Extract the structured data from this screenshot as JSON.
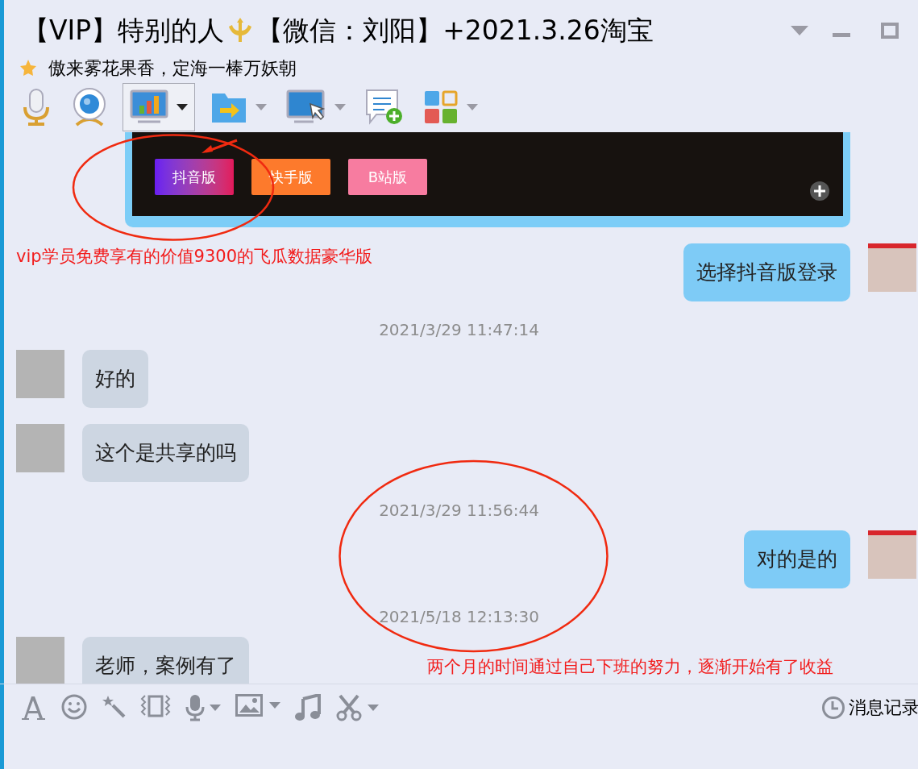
{
  "window": {
    "title": "【VIP】特别的人",
    "title_suffix": "【微信：刘阳】+2021.3.26淘宝",
    "signature": "傲来雾花果香，定海一棒万妖朝"
  },
  "toolbar": [
    {
      "kind": "mic",
      "selected": false,
      "dropdown": false
    },
    {
      "kind": "camera",
      "selected": false,
      "dropdown": false
    },
    {
      "kind": "screen-chart",
      "selected": true,
      "dropdown": true
    },
    {
      "kind": "folder",
      "selected": false,
      "dropdown": true
    },
    {
      "kind": "remote",
      "selected": false,
      "dropdown": true
    },
    {
      "kind": "chat-add",
      "selected": false,
      "dropdown": false
    },
    {
      "kind": "apps",
      "selected": false,
      "dropdown": true
    }
  ],
  "messages": [
    {
      "kind": "image",
      "outgoing": true,
      "buttons": [
        "抖音版",
        "快手版",
        "B站版"
      ]
    },
    {
      "kind": "text",
      "outgoing": true,
      "text": "选择抖音版登录"
    },
    {
      "kind": "time",
      "text": "2021/3/29 11:47:14"
    },
    {
      "kind": "text",
      "outgoing": false,
      "text": "好的"
    },
    {
      "kind": "text",
      "outgoing": false,
      "text": "这个是共享的吗"
    },
    {
      "kind": "time",
      "text": "2021/3/29 11:56:44"
    },
    {
      "kind": "text",
      "outgoing": true,
      "text": "对的是的"
    },
    {
      "kind": "time",
      "text": "2021/5/18 12:13:30"
    },
    {
      "kind": "text",
      "outgoing": false,
      "text": "老师，案例有了"
    }
  ],
  "annotations": [
    "vip学员免费享有的价值9300的飞瓜数据豪华版",
    "两个月的时间通过自己下班的努力，逐渐开始有了收益"
  ],
  "input_toolbar": {
    "history_label": "消息记录"
  }
}
